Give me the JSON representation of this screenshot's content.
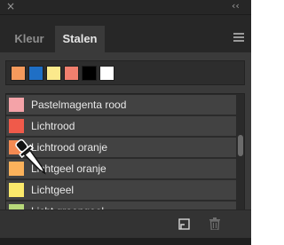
{
  "titlebar": {
    "close_glyph": "×",
    "collapse_glyph": "‹‹"
  },
  "tabs": [
    {
      "label": "Kleur",
      "active": false
    },
    {
      "label": "Stalen",
      "active": true
    }
  ],
  "recent_swatches": [
    "#f59a5c",
    "#1f6fc5",
    "#fbe98c",
    "#f07f6e",
    "#000000",
    "#ffffff"
  ],
  "swatches": [
    {
      "label": "Pastelmagenta rood",
      "color": "#f4a3a8"
    },
    {
      "label": "Lichtrood",
      "color": "#f05a4a"
    },
    {
      "label": "Lichtrood oranje",
      "color": "#f58a52"
    },
    {
      "label": "Lichtgeel oranje",
      "color": "#fbb25b"
    },
    {
      "label": "Lichtgeel",
      "color": "#fbe96b"
    },
    {
      "label": "Licht groengeel",
      "color": "#b7d87a"
    }
  ],
  "icons": {
    "menu": "hamburger-menu-icon",
    "new_swatch": "new-swatch-icon",
    "delete": "trash-icon",
    "eyedropper": "eyedropper-icon"
  },
  "colors": {
    "panel_bg": "#2f2f2f",
    "row_bg": "#424242",
    "active_tab": "#3a3a3a"
  }
}
